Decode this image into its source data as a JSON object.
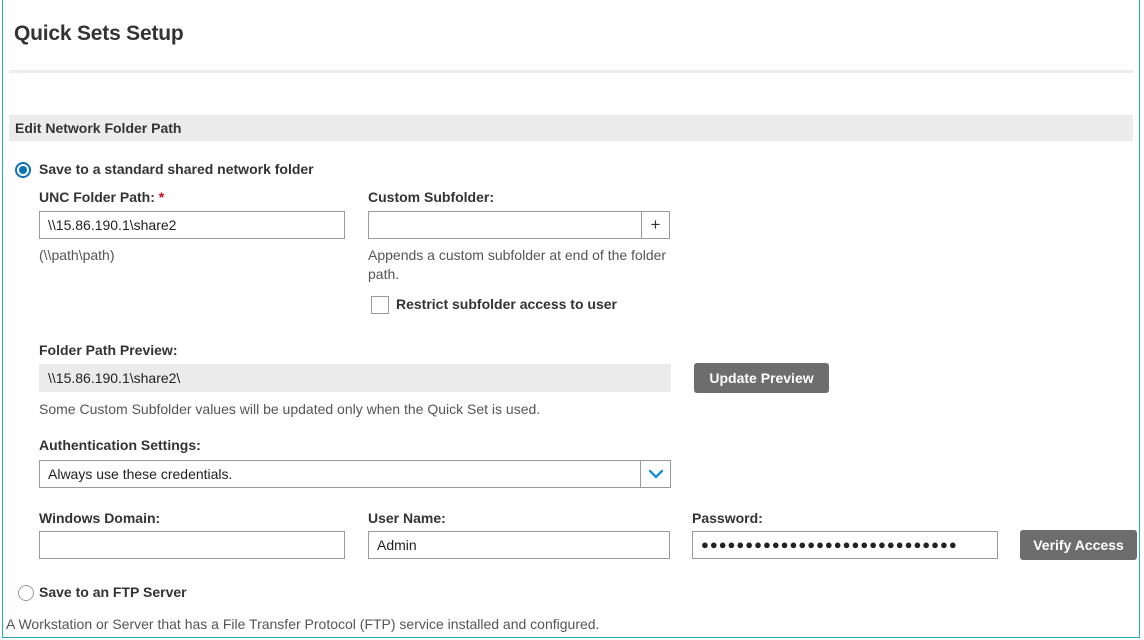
{
  "header": {
    "title": "Quick Sets Setup"
  },
  "section": {
    "title": "Edit Network Folder Path"
  },
  "options": {
    "standard": {
      "label": "Save to a standard shared network folder",
      "selected": true
    },
    "ftp": {
      "label": "Save to an FTP Server",
      "selected": false,
      "description": "A Workstation or Server that has a File Transfer Protocol (FTP) service installed and configured."
    }
  },
  "unc": {
    "label": "UNC Folder Path:",
    "required_marker": "*",
    "value": "\\\\15.86.190.1\\share2",
    "hint": "(\\\\path\\path)"
  },
  "subfolder": {
    "label": "Custom Subfolder:",
    "value": "",
    "add_label": "+",
    "help": "Appends a custom subfolder at end of the folder path.",
    "restrict_label": "Restrict subfolder access to user",
    "restrict_checked": false
  },
  "preview": {
    "label": "Folder Path Preview:",
    "value": "\\\\15.86.190.1\\share2\\",
    "button_label": "Update Preview",
    "note": "Some Custom Subfolder values will be updated only when the Quick Set is used."
  },
  "auth": {
    "label": "Authentication Settings:",
    "selected": "Always use these credentials.",
    "chevron_icon": "chevron-down-icon",
    "chevron_color": "#1a8fd0"
  },
  "credentials": {
    "domain_label": "Windows Domain:",
    "domain_value": "",
    "user_label": "User Name:",
    "user_value": "Admin",
    "password_label": "Password:",
    "password_value": "●●●●●●●●●●●●●●●●●●●●●●●●●●●●●",
    "verify_label": "Verify Access"
  },
  "colors": {
    "accent": "#0b72b8",
    "button_bg": "#6d6d6d",
    "frame_border": "#2aa9b5",
    "required": "#d0021b"
  }
}
